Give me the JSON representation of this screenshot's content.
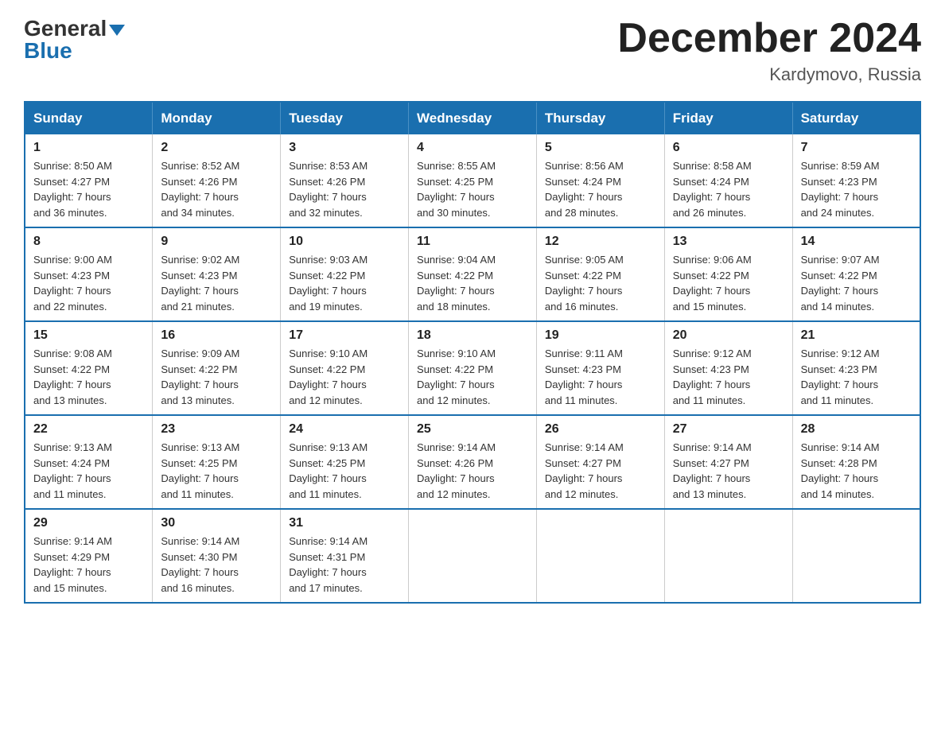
{
  "header": {
    "logo": {
      "general": "General",
      "blue": "Blue"
    },
    "title": "December 2024",
    "location": "Kardymovo, Russia"
  },
  "calendar": {
    "days_of_week": [
      "Sunday",
      "Monday",
      "Tuesday",
      "Wednesday",
      "Thursday",
      "Friday",
      "Saturday"
    ],
    "weeks": [
      [
        {
          "day": "1",
          "info": "Sunrise: 8:50 AM\nSunset: 4:27 PM\nDaylight: 7 hours\nand 36 minutes."
        },
        {
          "day": "2",
          "info": "Sunrise: 8:52 AM\nSunset: 4:26 PM\nDaylight: 7 hours\nand 34 minutes."
        },
        {
          "day": "3",
          "info": "Sunrise: 8:53 AM\nSunset: 4:26 PM\nDaylight: 7 hours\nand 32 minutes."
        },
        {
          "day": "4",
          "info": "Sunrise: 8:55 AM\nSunset: 4:25 PM\nDaylight: 7 hours\nand 30 minutes."
        },
        {
          "day": "5",
          "info": "Sunrise: 8:56 AM\nSunset: 4:24 PM\nDaylight: 7 hours\nand 28 minutes."
        },
        {
          "day": "6",
          "info": "Sunrise: 8:58 AM\nSunset: 4:24 PM\nDaylight: 7 hours\nand 26 minutes."
        },
        {
          "day": "7",
          "info": "Sunrise: 8:59 AM\nSunset: 4:23 PM\nDaylight: 7 hours\nand 24 minutes."
        }
      ],
      [
        {
          "day": "8",
          "info": "Sunrise: 9:00 AM\nSunset: 4:23 PM\nDaylight: 7 hours\nand 22 minutes."
        },
        {
          "day": "9",
          "info": "Sunrise: 9:02 AM\nSunset: 4:23 PM\nDaylight: 7 hours\nand 21 minutes."
        },
        {
          "day": "10",
          "info": "Sunrise: 9:03 AM\nSunset: 4:22 PM\nDaylight: 7 hours\nand 19 minutes."
        },
        {
          "day": "11",
          "info": "Sunrise: 9:04 AM\nSunset: 4:22 PM\nDaylight: 7 hours\nand 18 minutes."
        },
        {
          "day": "12",
          "info": "Sunrise: 9:05 AM\nSunset: 4:22 PM\nDaylight: 7 hours\nand 16 minutes."
        },
        {
          "day": "13",
          "info": "Sunrise: 9:06 AM\nSunset: 4:22 PM\nDaylight: 7 hours\nand 15 minutes."
        },
        {
          "day": "14",
          "info": "Sunrise: 9:07 AM\nSunset: 4:22 PM\nDaylight: 7 hours\nand 14 minutes."
        }
      ],
      [
        {
          "day": "15",
          "info": "Sunrise: 9:08 AM\nSunset: 4:22 PM\nDaylight: 7 hours\nand 13 minutes."
        },
        {
          "day": "16",
          "info": "Sunrise: 9:09 AM\nSunset: 4:22 PM\nDaylight: 7 hours\nand 13 minutes."
        },
        {
          "day": "17",
          "info": "Sunrise: 9:10 AM\nSunset: 4:22 PM\nDaylight: 7 hours\nand 12 minutes."
        },
        {
          "day": "18",
          "info": "Sunrise: 9:10 AM\nSunset: 4:22 PM\nDaylight: 7 hours\nand 12 minutes."
        },
        {
          "day": "19",
          "info": "Sunrise: 9:11 AM\nSunset: 4:23 PM\nDaylight: 7 hours\nand 11 minutes."
        },
        {
          "day": "20",
          "info": "Sunrise: 9:12 AM\nSunset: 4:23 PM\nDaylight: 7 hours\nand 11 minutes."
        },
        {
          "day": "21",
          "info": "Sunrise: 9:12 AM\nSunset: 4:23 PM\nDaylight: 7 hours\nand 11 minutes."
        }
      ],
      [
        {
          "day": "22",
          "info": "Sunrise: 9:13 AM\nSunset: 4:24 PM\nDaylight: 7 hours\nand 11 minutes."
        },
        {
          "day": "23",
          "info": "Sunrise: 9:13 AM\nSunset: 4:25 PM\nDaylight: 7 hours\nand 11 minutes."
        },
        {
          "day": "24",
          "info": "Sunrise: 9:13 AM\nSunset: 4:25 PM\nDaylight: 7 hours\nand 11 minutes."
        },
        {
          "day": "25",
          "info": "Sunrise: 9:14 AM\nSunset: 4:26 PM\nDaylight: 7 hours\nand 12 minutes."
        },
        {
          "day": "26",
          "info": "Sunrise: 9:14 AM\nSunset: 4:27 PM\nDaylight: 7 hours\nand 12 minutes."
        },
        {
          "day": "27",
          "info": "Sunrise: 9:14 AM\nSunset: 4:27 PM\nDaylight: 7 hours\nand 13 minutes."
        },
        {
          "day": "28",
          "info": "Sunrise: 9:14 AM\nSunset: 4:28 PM\nDaylight: 7 hours\nand 14 minutes."
        }
      ],
      [
        {
          "day": "29",
          "info": "Sunrise: 9:14 AM\nSunset: 4:29 PM\nDaylight: 7 hours\nand 15 minutes."
        },
        {
          "day": "30",
          "info": "Sunrise: 9:14 AM\nSunset: 4:30 PM\nDaylight: 7 hours\nand 16 minutes."
        },
        {
          "day": "31",
          "info": "Sunrise: 9:14 AM\nSunset: 4:31 PM\nDaylight: 7 hours\nand 17 minutes."
        },
        {
          "day": "",
          "info": ""
        },
        {
          "day": "",
          "info": ""
        },
        {
          "day": "",
          "info": ""
        },
        {
          "day": "",
          "info": ""
        }
      ]
    ]
  }
}
